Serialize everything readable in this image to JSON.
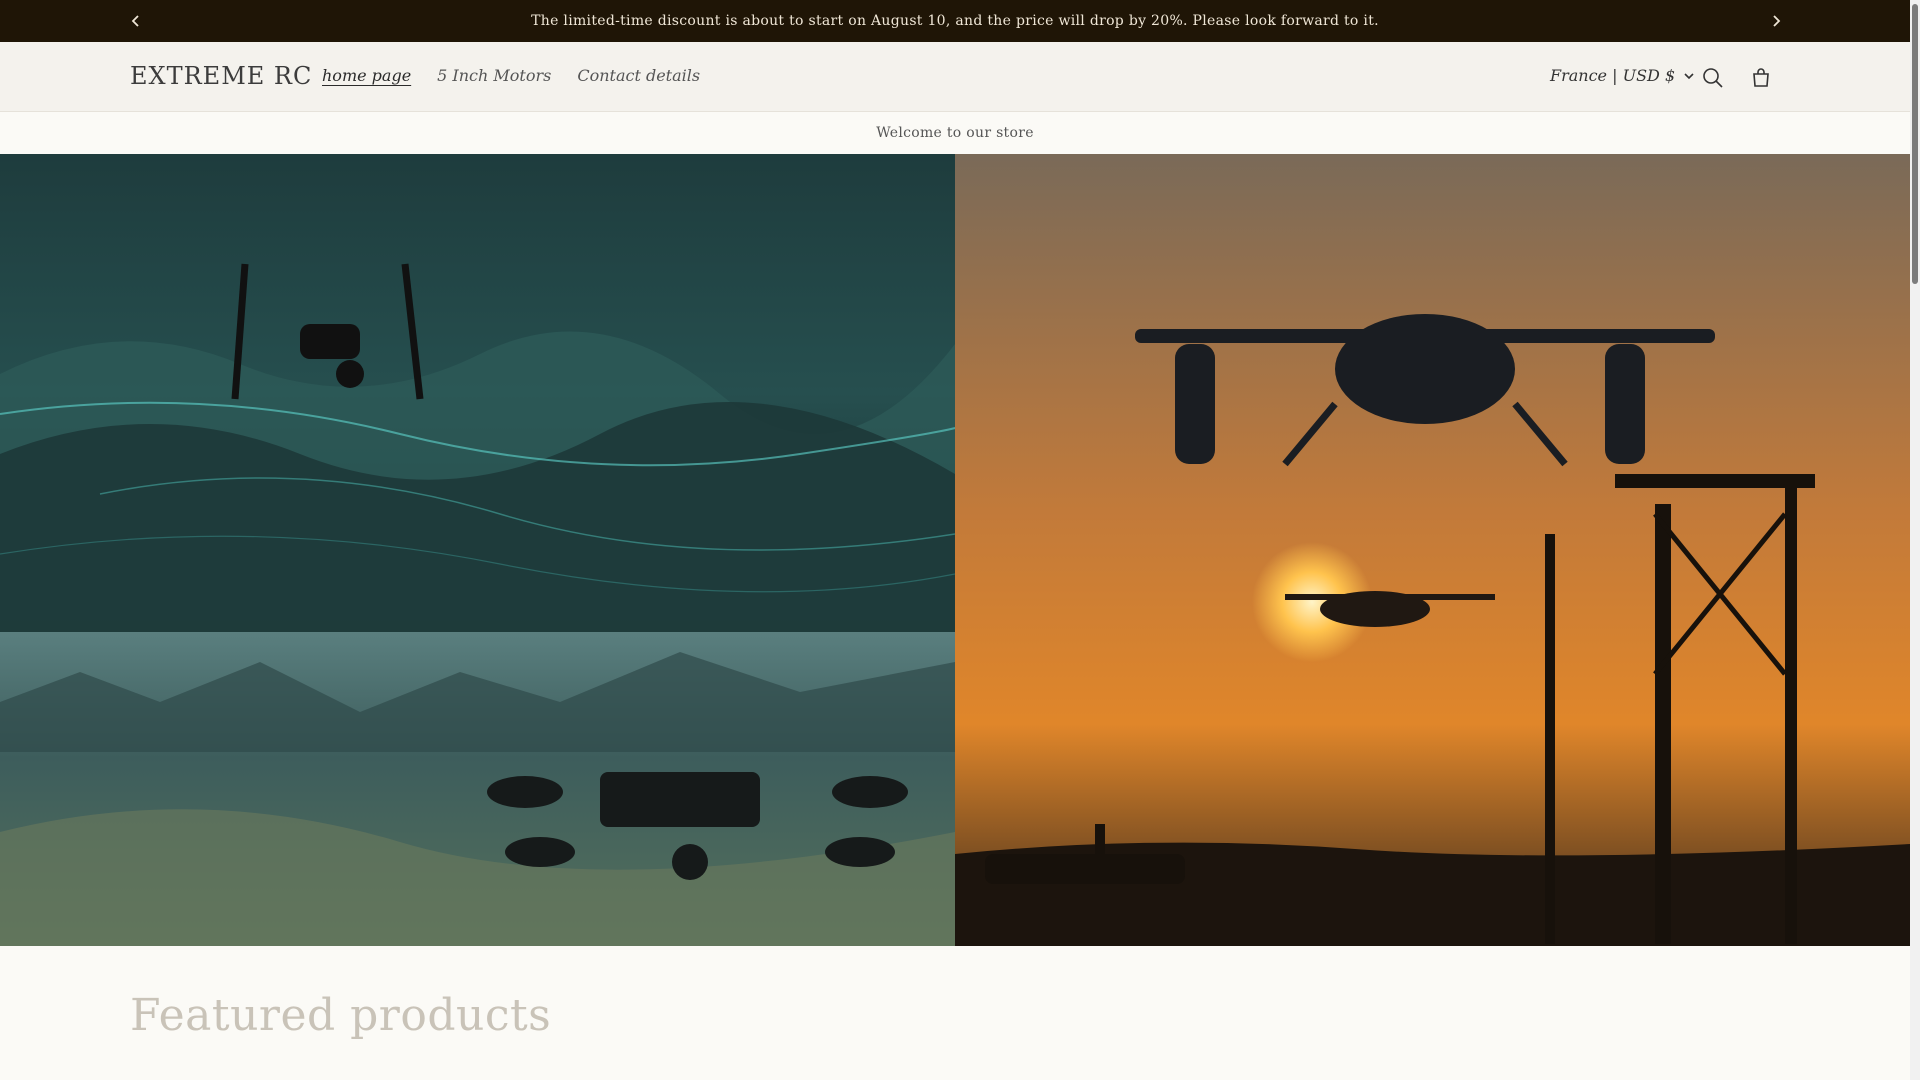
{
  "announcement": {
    "text": "The limited-time discount is about to start on August 10, and the price will drop by 20%. Please look forward to it.",
    "prev_icon": "chevron-left-icon",
    "next_icon": "chevron-right-icon"
  },
  "header": {
    "logo": "EXTREME RC",
    "nav": [
      {
        "label": "home page",
        "active": true
      },
      {
        "label": "5 Inch Motors",
        "active": false
      },
      {
        "label": "Contact details",
        "active": false
      }
    ],
    "locale": "France | USD $",
    "icons": [
      "search-icon",
      "cart-icon"
    ]
  },
  "welcome": "Welcome to our store",
  "hero": {
    "images": [
      "drone-over-digital-terrain",
      "drone-over-mountain-valley",
      "drones-at-sunset-port"
    ]
  },
  "featured": {
    "heading": "Featured products"
  },
  "colors": {
    "announcement_bg": "#1f1506",
    "header_bg": "#f4f2ed",
    "page_bg": "#fbfaf6"
  }
}
